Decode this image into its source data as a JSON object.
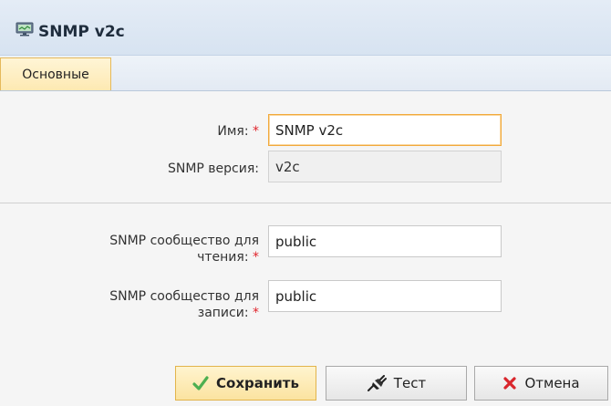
{
  "window": {
    "title": "SNMP v2c"
  },
  "tabs": [
    {
      "label": "Основные",
      "active": true
    }
  ],
  "form": {
    "name": {
      "label": "Имя:",
      "required": "*",
      "value": "SNMP v2c"
    },
    "version": {
      "label": "SNMP версия:",
      "value": "v2c"
    },
    "read_community": {
      "label_line1": "SNMP сообщество для",
      "label_line2": "чтения:",
      "required": "*",
      "value": "public"
    },
    "write_community": {
      "label_line1": "SNMP сообщество для",
      "label_line2": "записи:",
      "required": "*",
      "value": "public"
    }
  },
  "buttons": {
    "save": {
      "label": "Сохранить",
      "icon": "checkmark-icon"
    },
    "test": {
      "label": "Тест",
      "icon": "plug-icon"
    },
    "cancel": {
      "label": "Отмена",
      "icon": "close-icon"
    }
  },
  "colors": {
    "accent": "#f2a93b",
    "required": "#e0242c",
    "save_check": "#4caf50",
    "cancel_x": "#d9262c"
  }
}
